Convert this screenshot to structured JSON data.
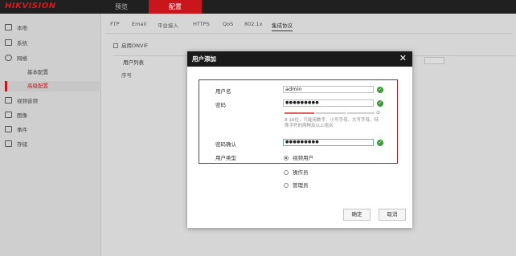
{
  "header": {
    "logo": "HIKVISION",
    "nav": [
      "预览",
      "配置"
    ]
  },
  "sidebar": {
    "items": [
      "本地",
      "系统",
      "网络",
      "视频音频",
      "图像",
      "事件",
      "存储"
    ],
    "network_sub": [
      "基本配置",
      "高级配置"
    ]
  },
  "main": {
    "tabs": [
      "FTP",
      "Email",
      "平台接入",
      "HTTPS",
      "QoS",
      "802.1x",
      "集成协议"
    ],
    "enable_onvif": "启用ONVIF",
    "user_list": "用户列表",
    "serial": "序号"
  },
  "dialog": {
    "title": "用户添加",
    "close": "✕",
    "username_label": "用户名",
    "username_value": "admin",
    "password_label": "密码",
    "password_value": "●●●●●●●●●",
    "hint": "8-16位，只能用数字、小写字母、大写字母、特殊字符的两种及以上组合",
    "confirm_label": "密码确认",
    "confirm_value": "●●●●●●●●●",
    "usertype_label": "用户类型",
    "usertypes": [
      "视频用户",
      "操作员",
      "管理员"
    ],
    "selected_usertype": "视频用户",
    "ok": "确定",
    "cancel": "取消"
  },
  "colors": {
    "accent": "#c9161d",
    "valid": "#3c9a37",
    "header": "#1a1a1a"
  },
  "icons": {
    "valid": "check-circle-icon",
    "eye": "eye-icon"
  }
}
